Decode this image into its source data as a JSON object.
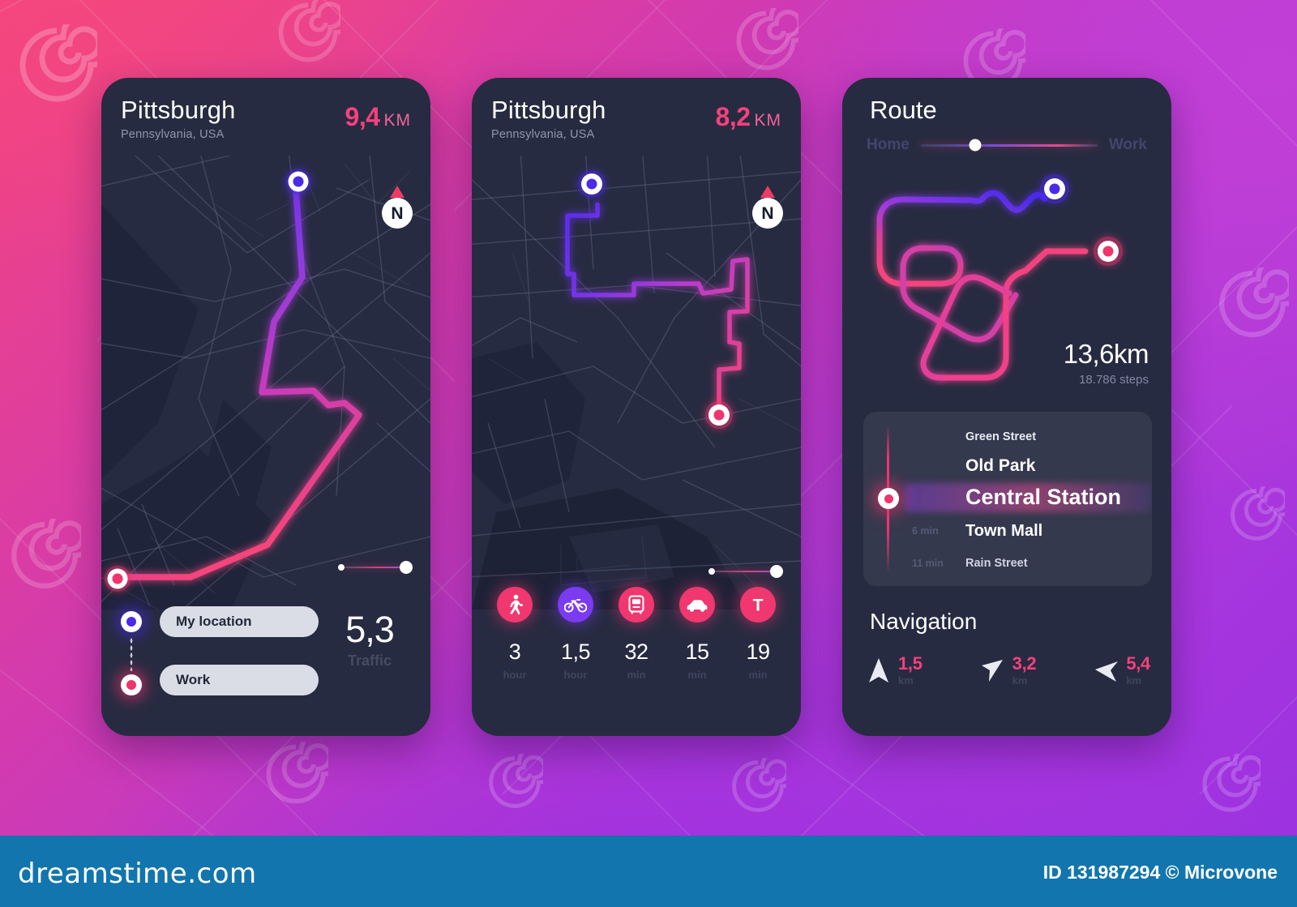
{
  "background": {
    "accent_pink": "#f4417c",
    "accent_purple": "#7b3bf0",
    "panel_bg": "#272b41"
  },
  "panel1": {
    "city": "Pittsburgh",
    "region": "Pennsylvania, USA",
    "distance_value": "9,4",
    "distance_unit": "KM",
    "compass_label": "N",
    "origin_field": "My location",
    "destination_field": "Work",
    "traffic_value": "5,3",
    "traffic_label": "Traffic"
  },
  "panel2": {
    "city": "Pittsburgh",
    "region": "Pennsylvania, USA",
    "distance_value": "8,2",
    "distance_unit": "KM",
    "compass_label": "N",
    "modes": [
      {
        "icon": "walk-icon",
        "value": "3",
        "unit": "hour",
        "color": "pink"
      },
      {
        "icon": "bike-icon",
        "value": "1,5",
        "unit": "hour",
        "color": "purple"
      },
      {
        "icon": "tram-icon",
        "value": "32",
        "unit": "min",
        "color": "pink"
      },
      {
        "icon": "car-icon",
        "value": "15",
        "unit": "min",
        "color": "pink"
      },
      {
        "icon": "transit-t-icon",
        "value": "19",
        "unit": "min",
        "color": "pink"
      }
    ]
  },
  "panel3": {
    "title": "Route",
    "from_label": "Home",
    "to_label": "Work",
    "distance": "13,6km",
    "steps": "18.786 steps",
    "stops": [
      {
        "time": "",
        "name": "Green Street",
        "active": false
      },
      {
        "time": "",
        "name": "Old Park",
        "active": false
      },
      {
        "time": "",
        "name": "Central Station",
        "active": true
      },
      {
        "time": "6 min",
        "name": "Town Mall",
        "active": false
      },
      {
        "time": "11 min",
        "name": "Rain Street",
        "active": false
      }
    ],
    "navigation_title": "Navigation",
    "navigation": [
      {
        "icon": "arrow-straight-icon",
        "value": "1,5",
        "unit": "km"
      },
      {
        "icon": "arrow-right-turn-icon",
        "value": "3,2",
        "unit": "km"
      },
      {
        "icon": "arrow-left-turn-icon",
        "value": "5,4",
        "unit": "km"
      }
    ]
  },
  "footer": {
    "logo": "dreamstime.com",
    "credit": "ID 131987294 © Microvone"
  }
}
